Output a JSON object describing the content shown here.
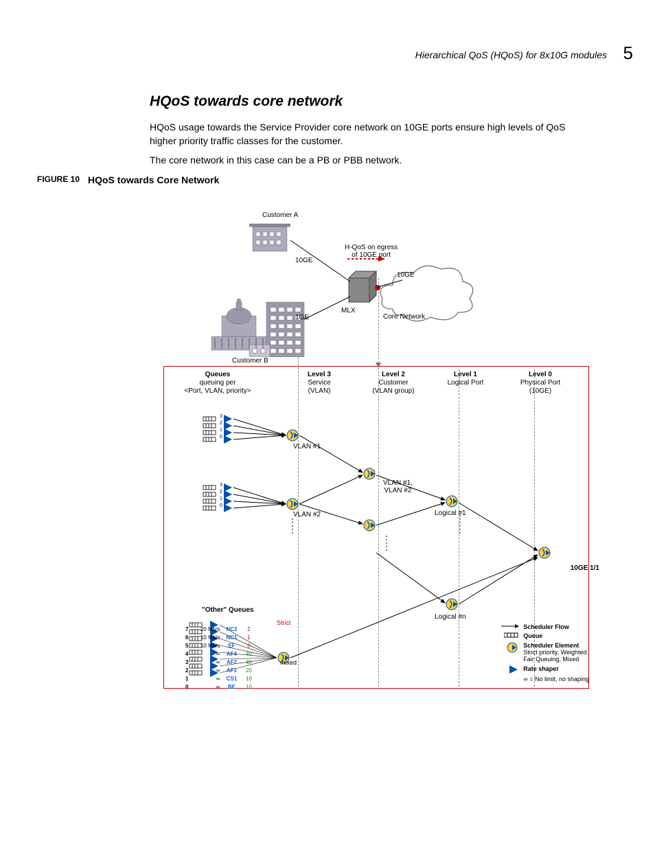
{
  "runningHead": "Hierarchical QoS (HQoS) for 8x10G modules",
  "chapterNum": "5",
  "heading": "HQoS towards core network",
  "para1": "HQoS usage towards the Service Provider core network on 10GE ports ensure high levels of QoS higher priority traffic classes for the customer.",
  "para2": "The core network in this case can be a PB or PBB network.",
  "figLabel": "FIGURE 10",
  "figTitle": "HQoS towards Core Network",
  "diagram": {
    "custA": "Customer A",
    "custB": "Customer B",
    "ge10_1": "10GE",
    "ge1": "1GE",
    "mlx": "MLX",
    "ge10_2": "10GE",
    "corenet": "Core Network",
    "hqos_l1": "H-QoS on egress",
    "hqos_l2": "of 10GE port",
    "cols": {
      "q_b": "Queues",
      "q_1": "queuing per",
      "q_2": "<Port, VLAN, priority>",
      "l3_b": "Level 3",
      "l3_1": "Service",
      "l3_2": "(VLAN)",
      "l2_b": "Level 2",
      "l2_1": "Customer",
      "l2_2": "(VLAN group)",
      "l1_b": "Level 1",
      "l1_1": "Logical Port",
      "l0_b": "Level 0",
      "l0_1": "Physical Port",
      "l0_2": "(10GE)"
    },
    "vlan1": "VLAN #1",
    "vlan2": "VLAN #2",
    "v12_1": "VLAN #1,",
    "v12_2": "VLAN #2",
    "log1": "Logical #1",
    "logn": "Logical #n",
    "port": "10GE 1/1",
    "other": "\"Other\" Queues",
    "strict": "Strict",
    "mixed": "mixed",
    "legend": {
      "sf": "Scheduler Flow",
      "q": "Queue",
      "se_b": "Scheduler Element",
      "se_1": "Strict priority, Weighted",
      "se_2": "Fair Queuing, Mixed",
      "rs": "Rate shaper",
      "inf": "∞ = No limit, no shaping"
    },
    "other_rows": [
      {
        "n": "7",
        "rate": "20 Mb/s",
        "cls": "NC2",
        "w": "2"
      },
      {
        "n": "6",
        "rate": "10 Mb/s",
        "cls": "NC1",
        "w": "1"
      },
      {
        "n": "5",
        "rate": "10 Mb/s",
        "cls": "EF",
        "w": "0"
      },
      {
        "n": "4",
        "rate": "∞",
        "cls": "AF4",
        "w": "40"
      },
      {
        "n": "3",
        "rate": "∞",
        "cls": "AF2",
        "w": "40"
      },
      {
        "n": "2",
        "rate": "∞",
        "cls": "AF1",
        "w": "20"
      },
      {
        "n": "1",
        "rate": "∞",
        "cls": "CS1",
        "w": "10"
      },
      {
        "n": "0",
        "rate": "∞",
        "cls": "BE",
        "w": "10"
      }
    ],
    "qnums": [
      "3",
      "2",
      "1",
      "0"
    ]
  }
}
